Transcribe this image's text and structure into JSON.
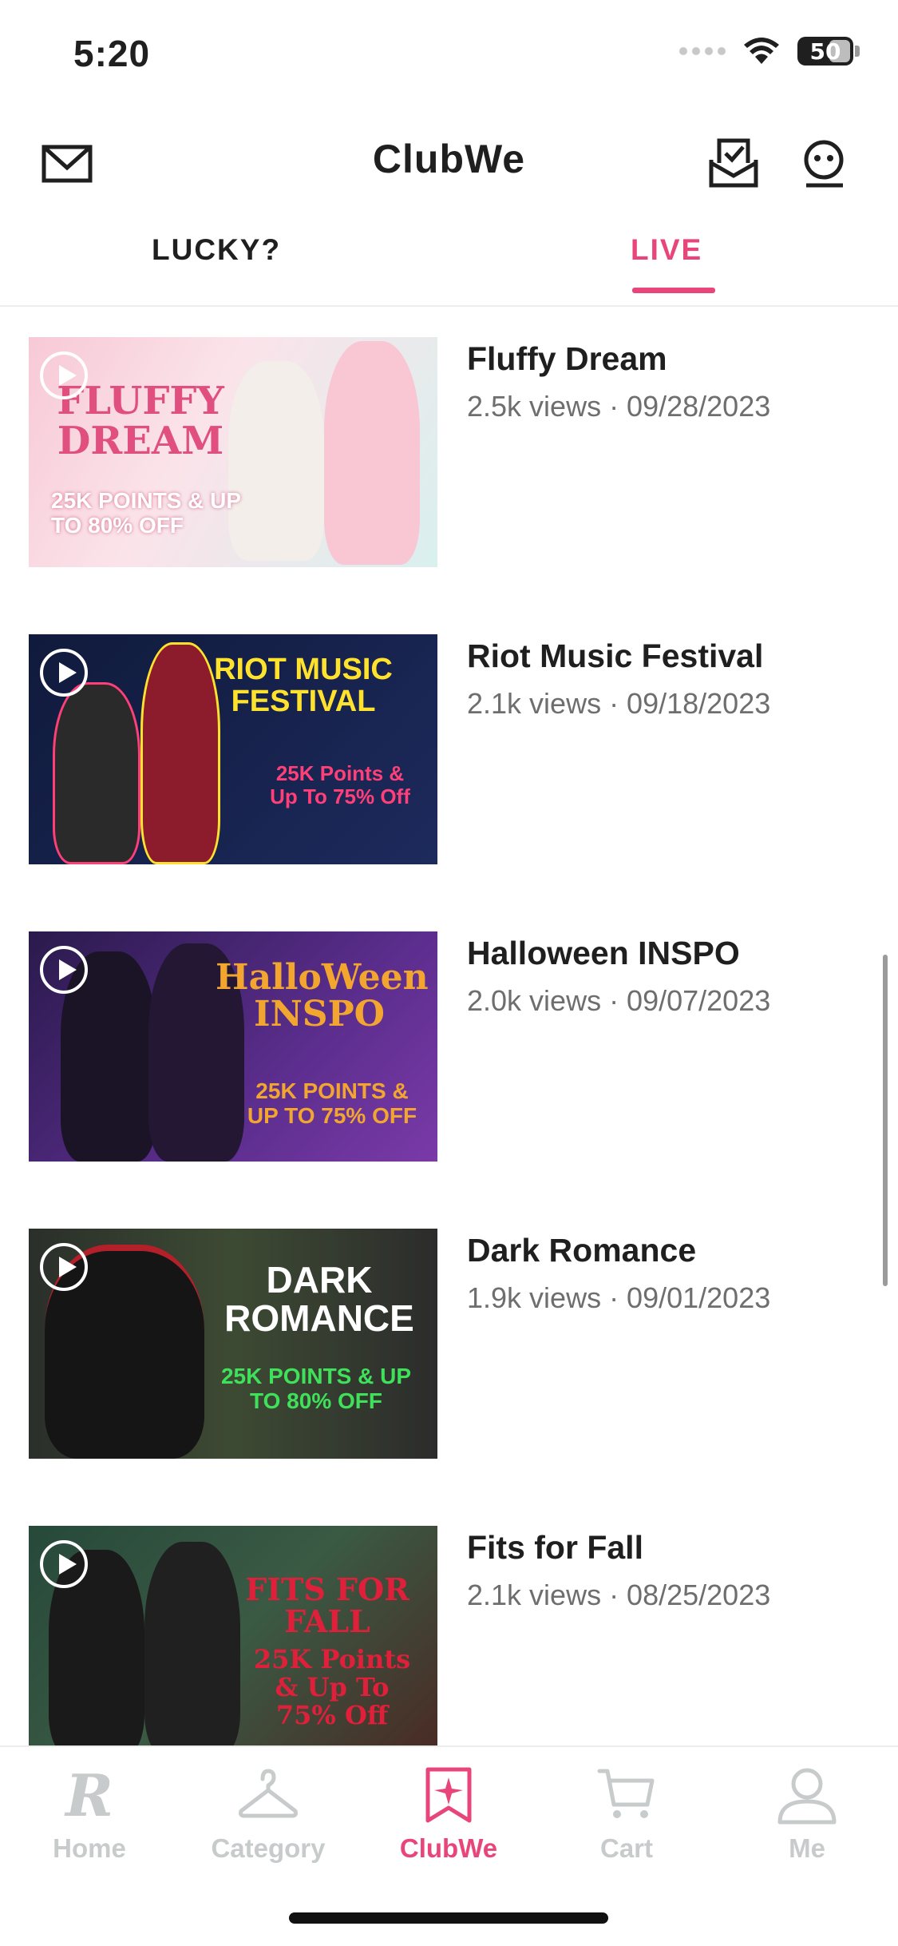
{
  "status_bar": {
    "time": "5:20",
    "battery": "50"
  },
  "header": {
    "title": "ClubWe"
  },
  "tabs": [
    {
      "label": "LUCKY?",
      "active": false
    },
    {
      "label": "LIVE",
      "active": true
    }
  ],
  "videos": [
    {
      "title": "Fluffy Dream",
      "meta": "2.5k views · 09/28/2023",
      "thumb_headline": "FLUFFY DREAM",
      "thumb_promo": "25K POINTS & UP TO 80% OFF"
    },
    {
      "title": "Riot Music Festival",
      "meta": "2.1k views · 09/18/2023",
      "thumb_headline": "RIOT MUSIC FESTIVAL",
      "thumb_promo": "25K Points & Up To 75% Off"
    },
    {
      "title": "Halloween INSPO",
      "meta": "2.0k views · 09/07/2023",
      "thumb_headline": "HalloWeen INSPO",
      "thumb_promo": "25K POINTS & UP TO 75% OFF"
    },
    {
      "title": "Dark Romance",
      "meta": "1.9k views · 09/01/2023",
      "thumb_headline": "DARK ROMANCE",
      "thumb_promo": "25K POINTS & UP TO 80% OFF"
    },
    {
      "title": "Fits for Fall",
      "meta": "2.1k views · 08/25/2023",
      "thumb_headline": "FITS FOR FALL",
      "thumb_promo": "25K Points & Up To 75% Off"
    }
  ],
  "bottom_nav": [
    {
      "label": "Home",
      "icon": "r-logo-icon",
      "active": false
    },
    {
      "label": "Category",
      "icon": "hanger-icon",
      "active": false
    },
    {
      "label": "ClubWe",
      "icon": "bookmark-star-icon",
      "active": true
    },
    {
      "label": "Cart",
      "icon": "cart-icon",
      "active": false
    },
    {
      "label": "Me",
      "icon": "person-icon",
      "active": false
    }
  ],
  "colors": {
    "accent": "#e8457b",
    "inactive_nav": "#c8cbcb",
    "meta_text": "#6e6e6e"
  }
}
